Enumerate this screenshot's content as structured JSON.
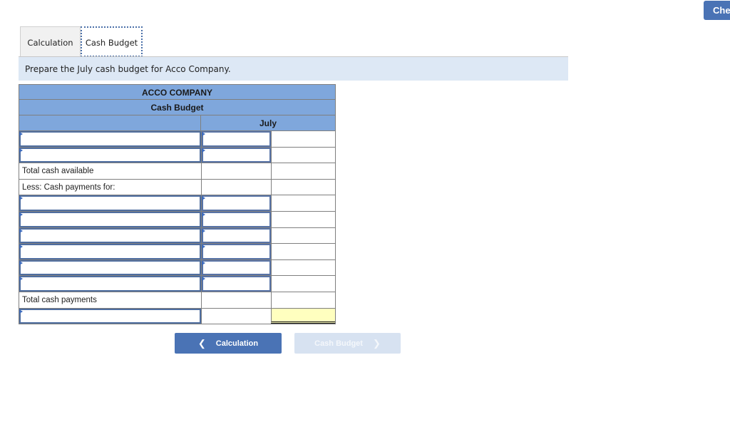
{
  "header": {
    "check_button_label": "Che"
  },
  "tabs": [
    {
      "label": "Calculation",
      "active": false
    },
    {
      "label": "Cash Budget",
      "active": true
    }
  ],
  "prompt": "Prepare the July cash budget for Acco Company.",
  "budget": {
    "company": "ACCO COMPANY",
    "title": "Cash Budget",
    "column_header": "July",
    "rows": [
      {
        "type": "input",
        "label": "",
        "value": "",
        "total": ""
      },
      {
        "type": "input",
        "label": "",
        "value": "",
        "total": ""
      },
      {
        "type": "label",
        "label": "Total cash available",
        "value": "",
        "total": ""
      },
      {
        "type": "label",
        "label": "Less: Cash payments for:",
        "value": "",
        "total": ""
      },
      {
        "type": "input",
        "label": "",
        "value": "",
        "total": ""
      },
      {
        "type": "input",
        "label": "",
        "value": "",
        "total": ""
      },
      {
        "type": "input",
        "label": "",
        "value": "",
        "total": ""
      },
      {
        "type": "input",
        "label": "",
        "value": "",
        "total": ""
      },
      {
        "type": "input",
        "label": "",
        "value": "",
        "total": ""
      },
      {
        "type": "input",
        "label": "",
        "value": "",
        "total": ""
      },
      {
        "type": "label",
        "label": "Total cash payments",
        "value": "",
        "total": ""
      },
      {
        "type": "final",
        "label": "",
        "value": "",
        "total": ""
      }
    ]
  },
  "navigation": {
    "prev_label": "Calculation",
    "next_label": "Cash Budget",
    "prev_icon": "chevron-left-icon",
    "next_icon": "chevron-right-icon"
  },
  "colors": {
    "accent": "#4a73b5",
    "header_fill": "#7fa7dc",
    "prompt_fill": "#dde8f5",
    "highlight_cell": "#ffffbf"
  }
}
